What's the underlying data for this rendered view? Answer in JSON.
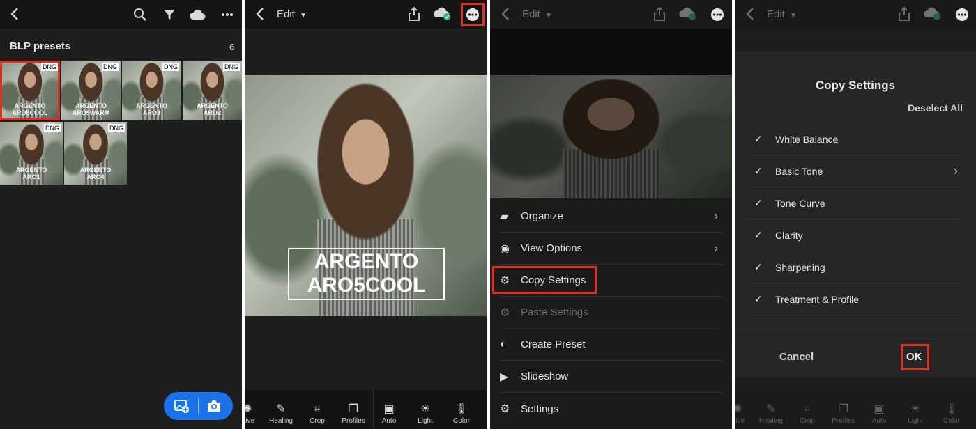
{
  "panel1": {
    "album_title": "BLP presets",
    "count": "6",
    "thumbs": [
      {
        "badge": "DNG",
        "line1": "ARGENTO",
        "line2": "ARO5COOL"
      },
      {
        "badge": "DNG",
        "line1": "ARGENTO",
        "line2": "ARO5WARM"
      },
      {
        "badge": "DNG",
        "line1": "ARGENTO",
        "line2": "ARO3"
      },
      {
        "badge": "DNG",
        "line1": "ARGENTO",
        "line2": "ARO2"
      },
      {
        "badge": "DNG",
        "line1": "ARGENTO",
        "line2": "ARO1"
      },
      {
        "badge": "DNG",
        "line1": "ARGENTO",
        "line2": "ARO4"
      }
    ]
  },
  "edit_dropdown_label": "Edit",
  "overlay": {
    "line1": "ARGENTO",
    "line2": "ARO5COOL"
  },
  "tools": [
    {
      "label": "ctive",
      "icon": "selective-icon"
    },
    {
      "label": "Healing",
      "icon": "healing-icon"
    },
    {
      "label": "Crop",
      "icon": "crop-icon"
    },
    {
      "label": "Profiles",
      "icon": "profiles-icon"
    },
    {
      "label": "Auto",
      "icon": "auto-icon"
    },
    {
      "label": "Light",
      "icon": "light-icon"
    },
    {
      "label": "Color",
      "icon": "color-icon"
    }
  ],
  "menu": {
    "items": [
      {
        "label": "Organize",
        "icon": "organize-icon",
        "chevron": true
      },
      {
        "label": "View Options",
        "icon": "view-options-icon",
        "chevron": true
      },
      {
        "label": "Copy Settings",
        "icon": "copy-settings-icon",
        "chevron": false
      },
      {
        "label": "Paste Settings",
        "icon": "paste-settings-icon",
        "chevron": false
      },
      {
        "label": "Create Preset",
        "icon": "create-preset-icon",
        "chevron": false
      },
      {
        "label": "Slideshow",
        "icon": "slideshow-icon",
        "chevron": false
      },
      {
        "label": "Settings",
        "icon": "settings-icon",
        "chevron": false
      }
    ]
  },
  "copy_settings": {
    "title": "Copy Settings",
    "deselect_all": "Deselect All",
    "items": [
      {
        "label": "White Balance",
        "checked": true
      },
      {
        "label": "Basic Tone",
        "checked": true
      },
      {
        "label": "Tone Curve",
        "checked": true
      },
      {
        "label": "Clarity",
        "checked": true
      },
      {
        "label": "Sharpening",
        "checked": true
      },
      {
        "label": "Treatment & Profile",
        "checked": true
      }
    ],
    "cancel": "Cancel",
    "ok": "OK"
  },
  "colors": {
    "highlight": "#e0301e",
    "fab_blue": "#1a73e8",
    "sync_green": "#2fb66d"
  }
}
